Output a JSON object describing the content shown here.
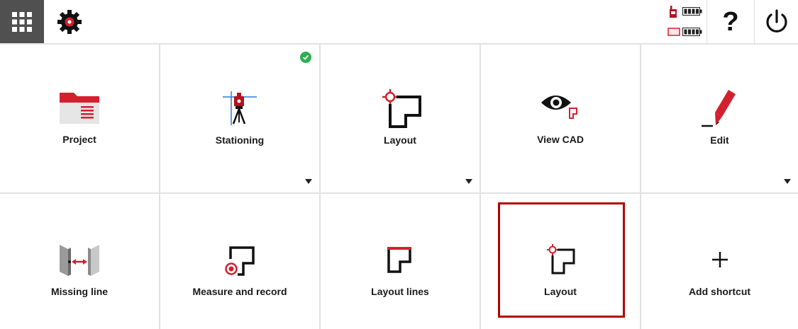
{
  "topbar": {
    "apps_icon": "grid-icon",
    "settings_icon": "gear-icon",
    "help_label": "?",
    "power_icon": "power-icon"
  },
  "tiles_row1": [
    {
      "label": "Project",
      "icon": "folder-icon",
      "dropdown": false,
      "check": false
    },
    {
      "label": "Stationing",
      "icon": "total-station-icon",
      "dropdown": true,
      "check": true
    },
    {
      "label": "Layout",
      "icon": "layout-icon",
      "dropdown": true,
      "check": false
    },
    {
      "label": "View CAD",
      "icon": "eye-icon",
      "dropdown": false,
      "check": false
    },
    {
      "label": "Edit",
      "icon": "pen-icon",
      "dropdown": true,
      "check": false
    }
  ],
  "tiles_row2": [
    {
      "label": "Missing line",
      "icon": "missing-line-icon"
    },
    {
      "label": "Measure and record",
      "icon": "measure-record-icon"
    },
    {
      "label": "Layout lines",
      "icon": "layout-lines-icon"
    },
    {
      "label": "Layout",
      "icon": "layout-icon"
    },
    {
      "label": "Add shortcut",
      "icon": "plus-icon"
    }
  ],
  "colors": {
    "accent": "#d2202f",
    "highlight": "#b30000",
    "success": "#2eae4f",
    "dark": "#1a1a1a"
  }
}
